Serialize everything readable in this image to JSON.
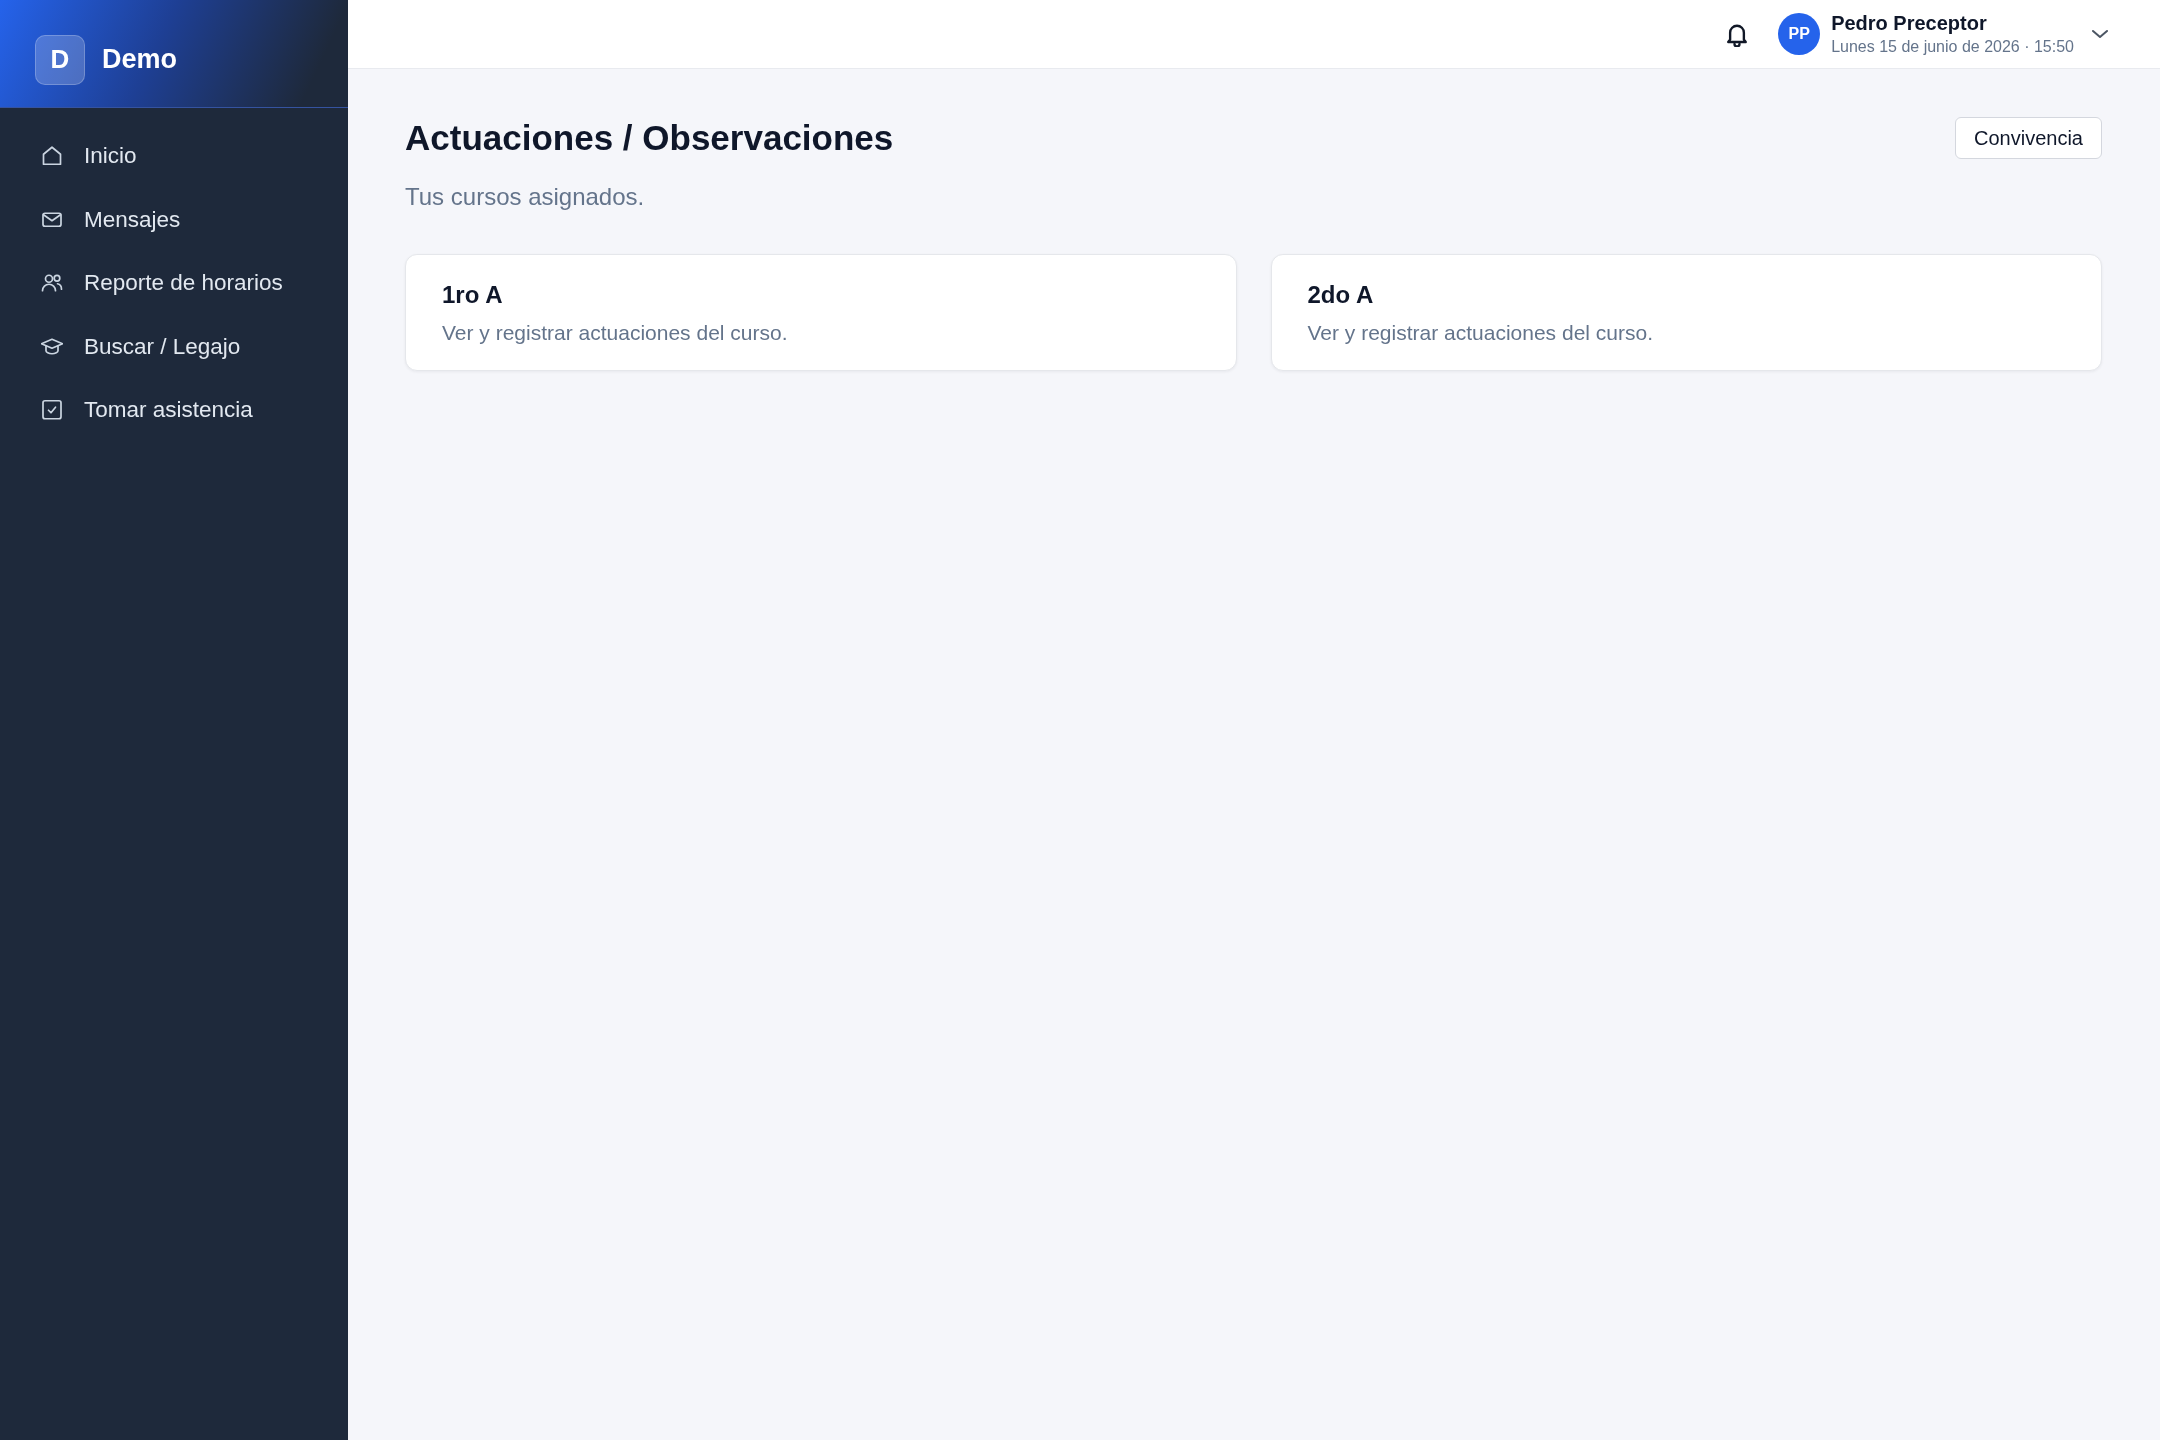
{
  "sidebar": {
    "brand": {
      "letter": "D",
      "name": "Demo"
    },
    "items": [
      {
        "label": "Inicio",
        "selected": false
      },
      {
        "label": "Mensajes",
        "selected": false
      },
      {
        "label": "Reporte de horarios",
        "selected": false
      },
      {
        "label": "Buscar / Legajo",
        "selected": false
      },
      {
        "label": "Tomar asistencia",
        "selected": false
      }
    ]
  },
  "topbar": {
    "user": {
      "initials": "PP",
      "name": "Pedro Preceptor",
      "datetime": "Lunes 15 de junio de 2026 · 15:50"
    }
  },
  "page": {
    "title": "Actuaciones / Observaciones",
    "subtitle": "Tus cursos asignados.",
    "action": "Convivencia"
  },
  "cards": [
    {
      "title": "1ro A",
      "description": "Ver y registrar actuaciones del curso."
    },
    {
      "title": "2do A",
      "description": "Ver y registrar actuaciones del curso."
    }
  ]
}
